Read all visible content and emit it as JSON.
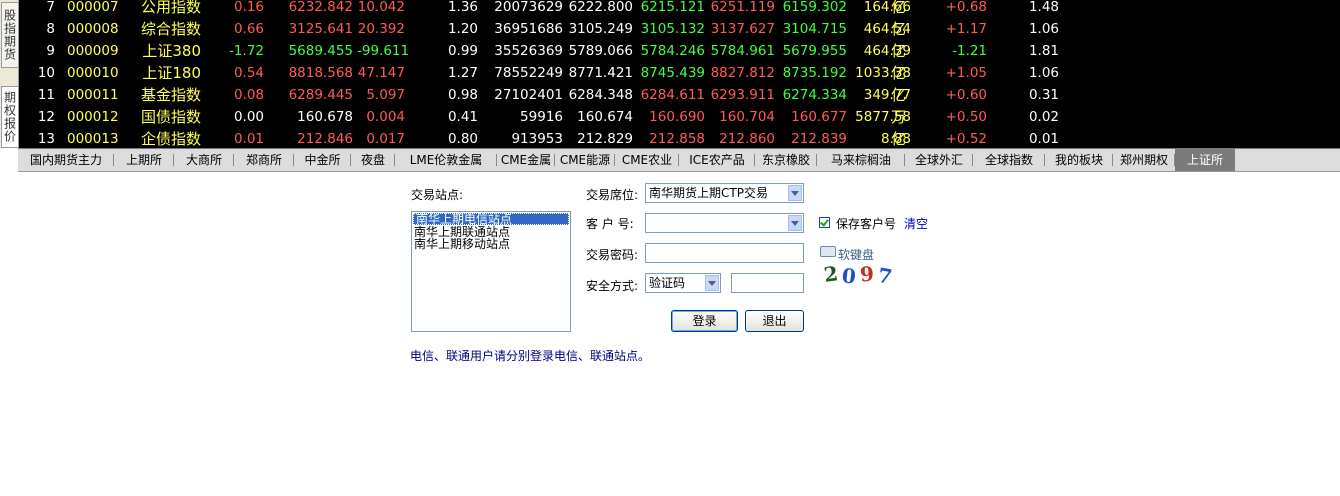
{
  "sidebar": {
    "tabs": [
      {
        "label": "股指期货",
        "active": false
      },
      {
        "label": "期权报价",
        "active": true
      }
    ]
  },
  "quotes": {
    "rows": [
      {
        "rank": "7",
        "code": "000007",
        "name": "公用指数",
        "change_pct": "0.16",
        "price": "6232.842",
        "change": "10.042",
        "ratio": "1.36",
        "volume": "20073629",
        "prev_close": "6222.800",
        "open": "6215.121",
        "high": "6251.119",
        "low": "6159.302",
        "amount": "164.66",
        "unit": "亿",
        "x1": "+0.68",
        "x2": "1.48"
      },
      {
        "rank": "8",
        "code": "000008",
        "name": "综合指数",
        "change_pct": "0.66",
        "price": "3125.641",
        "change": "20.392",
        "ratio": "1.20",
        "volume": "36951686",
        "prev_close": "3105.249",
        "open": "3105.132",
        "high": "3137.627",
        "low": "3104.715",
        "amount": "464.54",
        "unit": "亿",
        "x1": "+1.17",
        "x2": "1.06"
      },
      {
        "rank": "9",
        "code": "000009",
        "name": "上证380",
        "change_pct": "-1.72",
        "price": "5689.455",
        "change": "-99.611",
        "ratio": "0.99",
        "volume": "35526369",
        "prev_close": "5789.066",
        "open": "5784.246",
        "high": "5784.961",
        "low": "5679.955",
        "amount": "464.39",
        "unit": "亿",
        "x1": "-1.21",
        "x2": "1.81"
      },
      {
        "rank": "10",
        "code": "000010",
        "name": "上证180",
        "change_pct": "0.54",
        "price": "8818.568",
        "change": "47.147",
        "ratio": "1.27",
        "volume": "78552249",
        "prev_close": "8771.421",
        "open": "8745.439",
        "high": "8827.812",
        "low": "8735.192",
        "amount": "1033.38",
        "unit": "亿",
        "x1": "+1.05",
        "x2": "1.06"
      },
      {
        "rank": "11",
        "code": "000011",
        "name": "基金指数",
        "change_pct": "0.08",
        "price": "6289.445",
        "change": "5.097",
        "ratio": "0.98",
        "volume": "27102401",
        "prev_close": "6284.348",
        "open": "6284.611",
        "high": "6293.911",
        "low": "6274.334",
        "amount": "349.77",
        "unit": "亿",
        "x1": "+0.60",
        "x2": "0.31"
      },
      {
        "rank": "12",
        "code": "000012",
        "name": "国债指数",
        "change_pct": "0.00",
        "price": "160.678",
        "change": "0.004",
        "ratio": "0.41",
        "volume": "59916",
        "prev_close": "160.674",
        "open": "160.690",
        "high": "160.704",
        "low": "160.677",
        "amount": "5877.58",
        "unit": "万",
        "x1": "+0.50",
        "x2": "0.02"
      },
      {
        "rank": "13",
        "code": "000013",
        "name": "企债指数",
        "change_pct": "0.01",
        "price": "212.846",
        "change": "0.017",
        "ratio": "0.80",
        "volume": "913953",
        "prev_close": "212.829",
        "open": "212.858",
        "high": "212.860",
        "low": "212.839",
        "amount": "8.88",
        "unit": "亿",
        "x1": "+0.52",
        "x2": "0.01"
      }
    ]
  },
  "tabbar": {
    "tabs": [
      "国内期货主力",
      "上期所",
      "大商所",
      "郑商所",
      "中金所",
      "夜盘",
      "LME伦敦金属",
      "CME金属",
      "CME能源",
      "CME农业",
      "ICE农产品",
      "东京橡胶",
      "马来棕榈油",
      "全球外汇",
      "全球指数",
      "我的板块",
      "郑州期权",
      "上证所"
    ],
    "active_index": 17
  },
  "login": {
    "station_label": "交易站点:",
    "stations": [
      "南华上期电信站点",
      "南华上期联通站点",
      "南华上期移动站点"
    ],
    "selected_station": 0,
    "seat_label": "交易席位:",
    "seat_value": "南华期货上期CTP交易",
    "account_label": "客 户 号:",
    "account_value": "",
    "save_account_label": "保存客户号",
    "save_account_checked": true,
    "clear_label": "清空",
    "password_label": "交易密码:",
    "password_value": "",
    "soft_keyboard_label": "软键盘",
    "security_label": "安全方式:",
    "security_value": "验证码",
    "captcha_input_value": "",
    "captcha_digits": [
      {
        "char": "2",
        "color": "#1a5a1a"
      },
      {
        "char": "0",
        "color": "#2050c0"
      },
      {
        "char": "9",
        "color": "#c03020"
      },
      {
        "char": "7",
        "color": "#2050c0"
      }
    ],
    "login_button": "登录",
    "exit_button": "退出",
    "notice": "电信、联通用户请分别登录电信、联通站点。"
  }
}
